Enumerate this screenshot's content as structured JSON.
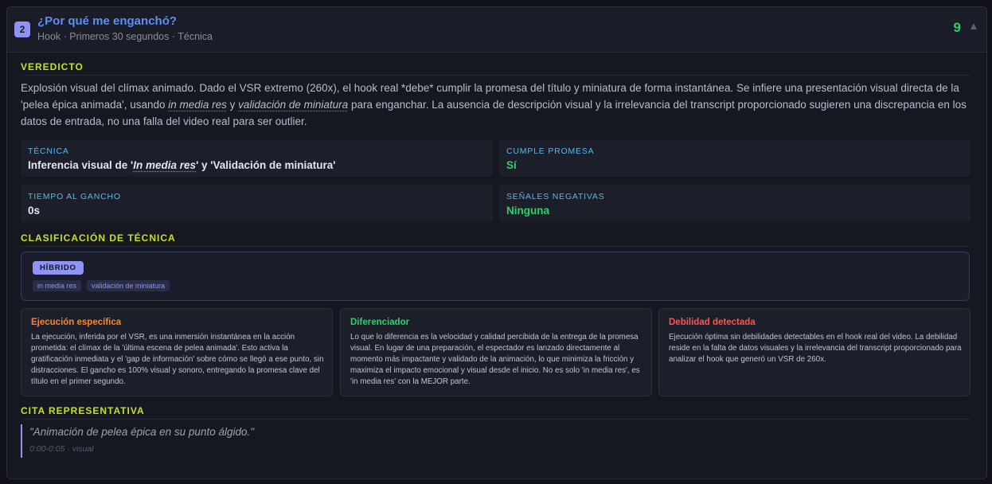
{
  "header": {
    "number": "2",
    "title": "¿Por qué me enganchó?",
    "subtitle": "Hook · Primeros 30 segundos · Técnica",
    "score": "9"
  },
  "verdict": {
    "label": "VEREDICTO",
    "text_1": "Explosión visual del clímax animado. Dado el VSR extremo (260x), el hook real *debe* cumplir la promesa del título y miniatura de forma instantánea. Se infiere una presentación visual directa de la 'pelea épica animada', usando ",
    "term_1": "in media res",
    "text_2": " y ",
    "term_2": "validación de miniatura",
    "text_3": " para enganchar. La ausencia de descripción visual y la irrelevancia del transcript proporcionado sugieren una discrepancia en los datos de entrada, no una falla del video real para ser outlier."
  },
  "stats": {
    "technique": {
      "label": "TÉCNICA",
      "prefix": "Inferencia visual de '",
      "term": "In media res",
      "suffix": "' y 'Validación de miniatura'"
    },
    "promise": {
      "label": "CUMPLE PROMESA",
      "value": "Sí"
    },
    "time": {
      "label": "TIEMPO AL GANCHO",
      "value": "0s"
    },
    "negative": {
      "label": "SEÑALES NEGATIVAS",
      "value": "Ninguna"
    }
  },
  "classification": {
    "label": "CLASIFICACIÓN DE TÉCNICA",
    "type": "HÍBRIDO",
    "tags": [
      "in media res",
      "validación de miniatura"
    ]
  },
  "panels": [
    {
      "title": "Ejecución específica",
      "color": "#ef8a3c",
      "body": "La ejecución, inferida por el VSR, es una inmersión instantánea en la acción prometida: el clímax de la 'última escena de pelea animada'. Esto activa la gratificación inmediata y el 'gap de información' sobre cómo se llegó a ese punto, sin distracciones. El gancho es 100% visual y sonoro, entregando la promesa clave del título en el primer segundo."
    },
    {
      "title": "Diferenciador",
      "color": "#2fcf6a",
      "body": "Lo que lo diferencia es la velocidad y calidad percibida de la entrega de la promesa visual. En lugar de una preparación, el espectador es lanzado directamente al momento más impactante y validado de la animación, lo que minimiza la fricción y maximiza el impacto emocional y visual desde el inicio. No es solo 'in media res', es 'in media res' con la MEJOR parte."
    },
    {
      "title": "Debilidad detectada",
      "color": "#f05a5a",
      "body": "Ejecución óptima sin debilidades detectables en el hook real del video. La debilidad reside en la falta de datos visuales y la irrelevancia del transcript proporcionado para analizar el hook que generó un VSR de 260x."
    }
  ],
  "quote": {
    "label": "CITA REPRESENTATIVA",
    "text": "\"Animación de pelea épica en su punto álgido.\"",
    "meta": "0:00-0:05 · visual"
  },
  "colors": {
    "accent": "#8f93f5",
    "section_label": "#c5e027",
    "stat_label": "#58b7ea",
    "positive": "#2fcf6a",
    "title": "#5f8ff0"
  }
}
